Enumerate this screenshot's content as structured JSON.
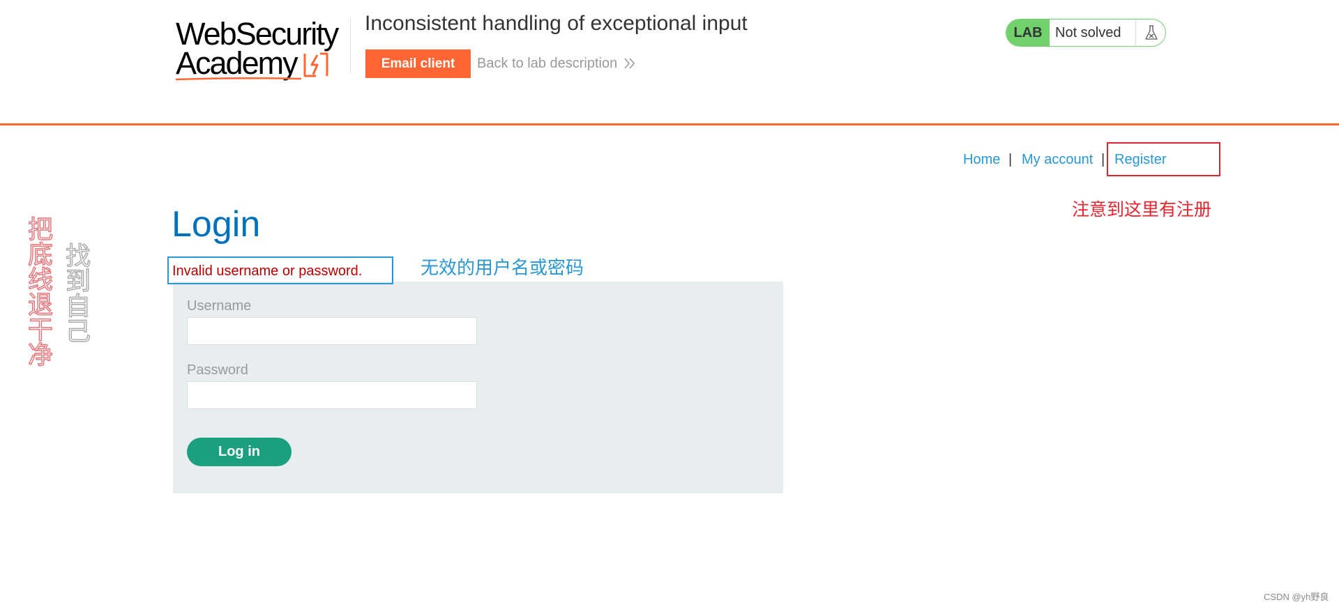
{
  "header": {
    "logo_line1": "WebSecurity",
    "logo_line2": "Academy",
    "lab_title": "Inconsistent handling of exceptional input",
    "email_client_label": "Email client",
    "back_link_label": "Back to lab description"
  },
  "lab_status": {
    "badge": "LAB",
    "state": "Not solved",
    "icon": "flask-icon"
  },
  "nav": {
    "items": [
      {
        "label": "Home"
      },
      {
        "label": "My account"
      },
      {
        "label": "Register"
      }
    ],
    "separator": "|"
  },
  "annotations": {
    "register_note": "注意到这里有注册",
    "error_note": "无效的用户名或密码",
    "vertical_red": "把底线退干净",
    "vertical_gray": "找到自己"
  },
  "login": {
    "title": "Login",
    "error_message": "Invalid username or password.",
    "username_label": "Username",
    "username_value": "",
    "password_label": "Password",
    "password_value": "",
    "submit_label": "Log in"
  },
  "watermark": "CSDN @yh野良",
  "colors": {
    "accent_orange": "#ff6633",
    "link_blue": "#2897d3",
    "title_blue": "#0071bc",
    "lab_green": "#70d16d",
    "button_green": "#1c9e81",
    "error_red": "#b80000",
    "annotation_red": "#e0242f",
    "panel_gray": "#e8eef0"
  }
}
